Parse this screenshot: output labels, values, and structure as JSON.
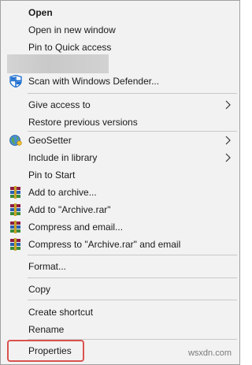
{
  "menu": {
    "open": "Open",
    "open_new_window": "Open in new window",
    "pin_quick_access": "Pin to Quick access",
    "scan_defender": "Scan with Windows Defender...",
    "give_access": "Give access to",
    "restore_versions": "Restore previous versions",
    "geosetter": "GeoSetter",
    "include_library": "Include in library",
    "pin_start": "Pin to Start",
    "add_archive": "Add to archive...",
    "add_archive_rar": "Add to \"Archive.rar\"",
    "compress_email": "Compress and email...",
    "compress_rar_email": "Compress to \"Archive.rar\" and email",
    "format": "Format...",
    "copy": "Copy",
    "create_shortcut": "Create shortcut",
    "rename": "Rename",
    "properties": "Properties"
  },
  "watermark": "wsxdn.com",
  "colors": {
    "menu_bg": "#f2f2f2",
    "highlight_border": "#d9534f",
    "defender_blue": "#1e6fd0"
  },
  "icons": {
    "defender": "shield-icon",
    "geosetter": "globe-icon",
    "winrar": "winrar-books-icon",
    "submenu": "chevron-right-icon"
  }
}
